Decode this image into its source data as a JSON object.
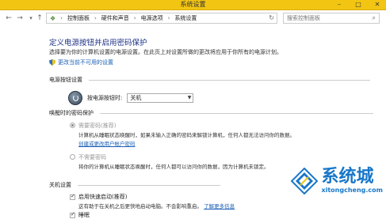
{
  "window": {
    "title": "系统设置",
    "minimize": "–",
    "maximize": "□",
    "close": "✕"
  },
  "nav": {
    "back": "←",
    "forward": "→",
    "up": "↑",
    "crumbs": [
      "控制面板",
      "硬件和声音",
      "电源选项",
      "系统设置"
    ],
    "separator": "›",
    "search_placeholder": "搜索控制面板"
  },
  "page": {
    "title": "定义电源按钮并启用密码保护",
    "description": "选择要为你的计算机设置的电源设置。在此页上对设置所做的更改将应用于你所有的电源计划。",
    "change_link": "更改当前不可用的设置"
  },
  "power_button": {
    "section": "电源按钮设置",
    "label": "按电源按钮时:",
    "value": "关机"
  },
  "wake_password": {
    "section": "唤醒时的密码保护",
    "require": {
      "title": "需要密码(推荐)",
      "desc": "计算机从睡眠状态唤醒时，如果未输入正确的密码来解锁计算机，任何人都无法访问你的数据。",
      "link": "创建或更改用户帐户密码",
      "selected": true
    },
    "no_require": {
      "title": "不需要密码",
      "desc": "将你的计算机从睡眠状态唤醒时，任何人都可以访问你的数据，因为计算机未锁定。",
      "selected": false
    }
  },
  "shutdown": {
    "section": "关机设置",
    "fast_startup": {
      "label": "启用快速启动(推荐)",
      "desc": "这有助于在关机之后更快地启动电脑。不会影响重启。",
      "link": "了解更多信息",
      "checked": true
    },
    "sleep": {
      "label": "睡眠",
      "checked": true
    }
  },
  "watermark": {
    "main": "系统城",
    "sub": "xitongcheng.com"
  },
  "colors": {
    "titlebar": "#f2c512",
    "link": "#1a5fb4",
    "title": "#1e3287",
    "watermark": "#1877c9"
  }
}
